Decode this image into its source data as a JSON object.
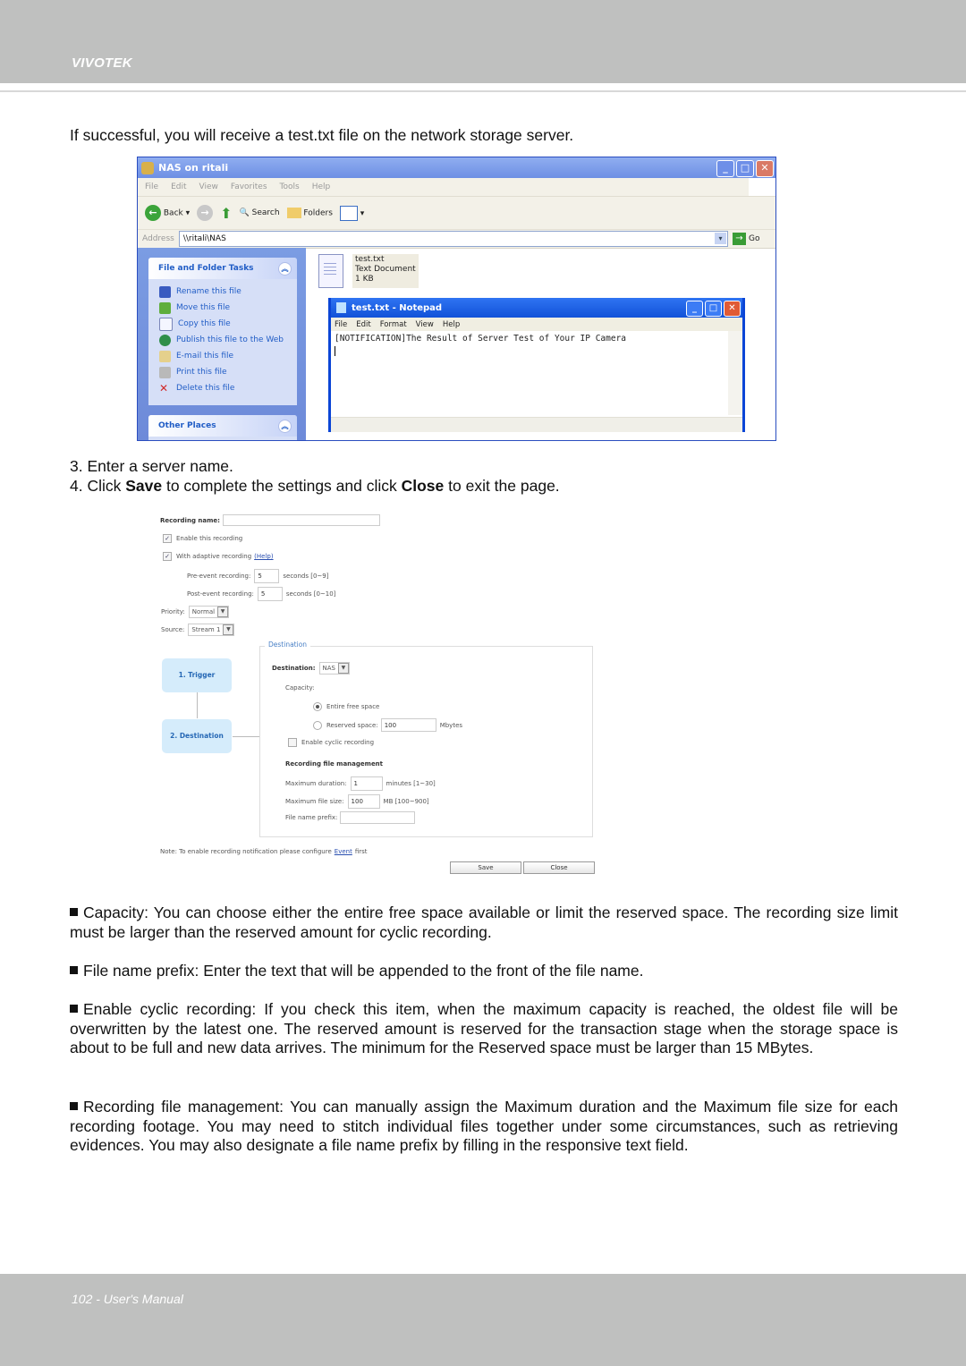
{
  "header": {
    "brand": "VIVOTEK"
  },
  "intro": "If successful, you will receive a test.txt file on the network storage server.",
  "explorer": {
    "title": "NAS on ritali",
    "menu": [
      "File",
      "Edit",
      "View",
      "Favorites",
      "Tools",
      "Help"
    ],
    "toolbar": {
      "back": "Back",
      "search": "Search",
      "folders": "Folders"
    },
    "address_label": "Address",
    "address_value": "\\\\ritali\\NAS",
    "go": "Go",
    "tasks_panel": {
      "title": "File and Folder Tasks",
      "items": [
        {
          "label": "Rename this file",
          "icon": "rename-icon",
          "color": "#3a5bc0"
        },
        {
          "label": "Move this file",
          "icon": "move-icon",
          "color": "#5fae3c"
        },
        {
          "label": "Copy this file",
          "icon": "copy-icon",
          "color": "#e8eefc"
        },
        {
          "label": "Publish this file to the Web",
          "icon": "globe-icon",
          "color": "#2f8f4a"
        },
        {
          "label": "E-mail this file",
          "icon": "email-icon",
          "color": "#e5d08c"
        },
        {
          "label": "Print this file",
          "icon": "print-icon",
          "color": "#b9b9b9"
        },
        {
          "label": "Delete this file",
          "icon": "delete-icon",
          "color": "#d02a2a"
        }
      ]
    },
    "other_places": "Other Places",
    "file": {
      "name": "test.txt",
      "type": "Text Document",
      "size": "1 KB"
    }
  },
  "notepad": {
    "title": "test.txt - Notepad",
    "menu": [
      "File",
      "Edit",
      "Format",
      "View",
      "Help"
    ],
    "content": "[NOTIFICATION]The Result of Server Test of Your IP Camera"
  },
  "steps": {
    "step3": "3. Enter a server name.",
    "step4_a": "4. Click ",
    "step4_save": "Save",
    "step4_b": " to complete the settings and click ",
    "step4_close": "Close",
    "step4_c": " to exit the page."
  },
  "recording": {
    "name_label": "Recording name:",
    "name_value": "",
    "enable_label": "Enable this recording",
    "enable_checked": true,
    "adaptive_label": "With adaptive recording",
    "adaptive_checked": true,
    "help_link": "(Help)",
    "pre_event_label": "Pre-event recording:",
    "pre_event_value": "5",
    "pre_event_unit": "seconds [0~9]",
    "post_event_label": "Post-event recording:",
    "post_event_value": "5",
    "post_event_unit": "seconds [0~10]",
    "priority_label": "Priority:",
    "priority_value": "Normal",
    "source_label": "Source:",
    "source_value": "Stream 1",
    "step1": "1. Trigger",
    "step2": "2. Destination",
    "legend": "Destination",
    "destination_label": "Destination:",
    "destination_value": "NAS",
    "capacity_label": "Capacity:",
    "entire_label": "Entire free space",
    "reserved_label": "Reserved space:",
    "reserved_value": "100",
    "reserved_unit": "Mbytes",
    "cyclic_label": "Enable cyclic recording",
    "rfm_label": "Recording file management",
    "max_duration_label": "Maximum duration:",
    "max_duration_value": "1",
    "max_duration_unit": "minutes [1~30]",
    "max_size_label": "Maximum file size:",
    "max_size_value": "100",
    "max_size_unit": "MB [100~900]",
    "prefix_label": "File name prefix:",
    "prefix_value": "",
    "note_a": "Note: To enable recording notification please configure",
    "note_link": "Event",
    "note_b": "first",
    "save": "Save",
    "close": "Close"
  },
  "bullets": [
    "Capacity: You can choose either the entire free space available or limit the reserved space. The recording size limit must be larger than the reserved amount for cyclic recording.",
    "File name prefix: Enter the text that will be appended to the front of the file name.",
    "Enable cyclic recording: If you check this item, when the maximum capacity is reached, the oldest file will be overwritten by the latest one. The reserved amount is reserved for the transaction stage when the storage space is about to be full and new data arrives. The minimum for the Reserved space must be larger than 15 MBytes.",
    "Recording file management: You can manually assign the Maximum duration and the Maximum file size for each recording footage. You may need to stitch individual files together under some circumstances, such as retrieving evidences. You may also designate a file name prefix by filling in the responsive text field."
  ],
  "footer": {
    "page": "102 - User's Manual"
  }
}
